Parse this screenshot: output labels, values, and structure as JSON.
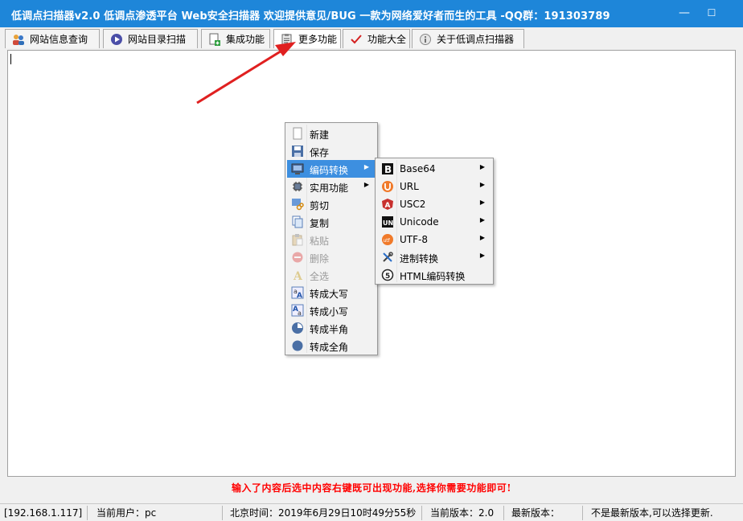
{
  "window": {
    "title": "低调点扫描器v2.0 低调点渗透平台 Web安全扫描器 欢迎提供意见/BUG  一款为网络爱好者而生的工具  -QQ群：191303789",
    "minimize_glyph": "—",
    "maximize_glyph": "☐",
    "title_bar_color": "#1e86d9"
  },
  "tabs": [
    {
      "label": "网站信息查询",
      "icon": "users-icon"
    },
    {
      "label": "网站目录扫描",
      "icon": "play-circle-icon"
    },
    {
      "label": "集成功能",
      "icon": "document-add-icon"
    },
    {
      "label": "更多功能",
      "icon": "clipboard-icon"
    },
    {
      "label": "功能大全",
      "icon": "checkmark-icon"
    },
    {
      "label": "关于低调点扫描器",
      "icon": "info-icon"
    }
  ],
  "context_menu": {
    "items": [
      {
        "label": "新建",
        "icon": "new-file-icon",
        "enabled": true
      },
      {
        "label": "保存",
        "icon": "save-icon",
        "enabled": true
      },
      {
        "label": "编码转换",
        "icon": "monitor-icon",
        "enabled": true,
        "submenu": true,
        "selected": true
      },
      {
        "label": "实用功能",
        "icon": "chip-icon",
        "enabled": true,
        "submenu": true
      },
      {
        "label": "剪切",
        "icon": "cut-icon",
        "enabled": true
      },
      {
        "label": "复制",
        "icon": "copy-icon",
        "enabled": true
      },
      {
        "label": "粘贴",
        "icon": "paste-icon",
        "enabled": false
      },
      {
        "label": "删除",
        "icon": "delete-icon",
        "enabled": false
      },
      {
        "label": "全选",
        "icon": "select-all-icon",
        "enabled": false
      },
      {
        "label": "转成大写",
        "icon": "uppercase-icon",
        "enabled": true
      },
      {
        "label": "转成小写",
        "icon": "lowercase-icon",
        "enabled": true
      },
      {
        "label": "转成半角",
        "icon": "half-circle-icon",
        "enabled": true
      },
      {
        "label": "转成全角",
        "icon": "full-circle-icon",
        "enabled": true
      }
    ]
  },
  "submenu": {
    "items": [
      {
        "label": "Base64",
        "icon": "bold-b-icon",
        "submenu": true
      },
      {
        "label": "URL",
        "icon": "orange-u-icon",
        "submenu": true
      },
      {
        "label": "USC2",
        "icon": "red-a-icon",
        "submenu": true
      },
      {
        "label": "Unicode",
        "icon": "un-icon",
        "submenu": true
      },
      {
        "label": "UTF-8",
        "icon": "orange-utf-icon",
        "submenu": true
      },
      {
        "label": "进制转换",
        "icon": "tools-icon",
        "submenu": true
      },
      {
        "label": "HTML编码转换",
        "icon": "html-icon",
        "submenu": false
      }
    ]
  },
  "hint": "输入了内容后选中内容右键既可出现功能,选择你需要功能即可!",
  "status_bar": {
    "ip": "[192.168.1.117]",
    "user": "当前用户：pc",
    "time": "北京时间：2019年6月29日10时49分55秒",
    "version": "当前版本：2.0",
    "latest": "最新版本：",
    "update": "不是最新版本,可以选择更新."
  },
  "annotation_arrow_color": "#e02020",
  "hint_color": "#ff0000",
  "selection_color": "#3d8fe0"
}
